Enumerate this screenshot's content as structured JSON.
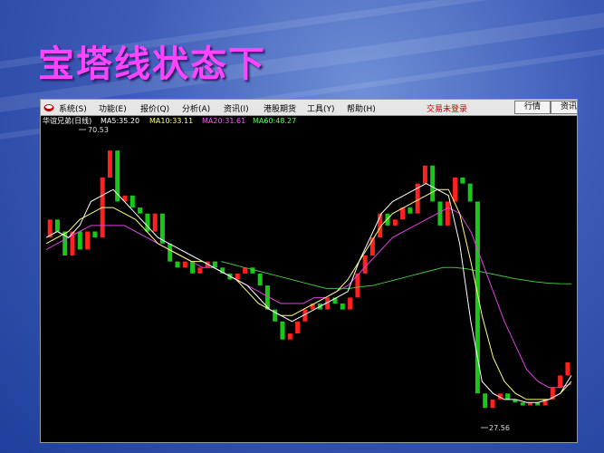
{
  "slide": {
    "title": "宝塔线状态下"
  },
  "menu": {
    "items": [
      "系统(S)",
      "功能(E)",
      "报价(Q)",
      "分析(A)",
      "资讯(I)",
      "港股期货",
      "工具(Y)",
      "帮助(H)"
    ],
    "login_status": "交易未登录",
    "tabs": [
      "行情",
      "资讯"
    ]
  },
  "infobar": {
    "stock": "华谊兄弟(日线)",
    "ma5": "MA5:35.20",
    "ma10": "MA10:33.11",
    "ma20": "MA20:31.61",
    "ma60": "MA60:48.27",
    "label_colors": {
      "stock": "#ffffff",
      "ma5": "#ffffff",
      "ma10": "#ffff66",
      "ma20": "#ff55ff",
      "ma60": "#55ff55"
    }
  },
  "chart_data": {
    "type": "bar",
    "title": "",
    "high_label": "70.53",
    "low_label": "27.56",
    "ylim": [
      24,
      74
    ],
    "colors": {
      "up": "#ff2020",
      "down": "#18c818",
      "ma5": "#ffffff",
      "ma10": "#ffff80",
      "ma20": "#e040e0",
      "ma60": "#40c040"
    },
    "tower_bars": [
      {
        "o": 56,
        "c": 59
      },
      {
        "o": 59,
        "c": 57
      },
      {
        "o": 57,
        "c": 53
      },
      {
        "o": 53,
        "c": 57
      },
      {
        "o": 57,
        "c": 54
      },
      {
        "o": 54,
        "c": 57
      },
      {
        "o": 57,
        "c": 56
      },
      {
        "o": 56,
        "c": 66
      },
      {
        "o": 66,
        "c": 70.5
      },
      {
        "o": 70.5,
        "c": 62
      },
      {
        "o": 62,
        "c": 63
      },
      {
        "o": 63,
        "c": 61
      },
      {
        "o": 61,
        "c": 60
      },
      {
        "o": 60,
        "c": 57
      },
      {
        "o": 57,
        "c": 60
      },
      {
        "o": 60,
        "c": 55
      },
      {
        "o": 55,
        "c": 52
      },
      {
        "o": 52,
        "c": 51
      },
      {
        "o": 51,
        "c": 52
      },
      {
        "o": 52,
        "c": 50
      },
      {
        "o": 50,
        "c": 51
      },
      {
        "o": 51,
        "c": 52
      },
      {
        "o": 52,
        "c": 51
      },
      {
        "o": 51,
        "c": 50
      },
      {
        "o": 50,
        "c": 49
      },
      {
        "o": 49,
        "c": 50
      },
      {
        "o": 50,
        "c": 51
      },
      {
        "o": 51,
        "c": 50
      },
      {
        "o": 50,
        "c": 48
      },
      {
        "o": 48,
        "c": 44
      },
      {
        "o": 44,
        "c": 42
      },
      {
        "o": 42,
        "c": 39
      },
      {
        "o": 39,
        "c": 40
      },
      {
        "o": 40,
        "c": 42
      },
      {
        "o": 42,
        "c": 44
      },
      {
        "o": 44,
        "c": 45
      },
      {
        "o": 45,
        "c": 44
      },
      {
        "o": 44,
        "c": 46
      },
      {
        "o": 46,
        "c": 45
      },
      {
        "o": 45,
        "c": 44
      },
      {
        "o": 44,
        "c": 46
      },
      {
        "o": 46,
        "c": 50
      },
      {
        "o": 50,
        "c": 53
      },
      {
        "o": 53,
        "c": 56
      },
      {
        "o": 56,
        "c": 60
      },
      {
        "o": 60,
        "c": 58
      },
      {
        "o": 58,
        "c": 59
      },
      {
        "o": 59,
        "c": 61
      },
      {
        "o": 61,
        "c": 60
      },
      {
        "o": 60,
        "c": 65
      },
      {
        "o": 65,
        "c": 68
      },
      {
        "o": 68,
        "c": 62
      },
      {
        "o": 62,
        "c": 58
      },
      {
        "o": 58,
        "c": 62
      },
      {
        "o": 62,
        "c": 66
      },
      {
        "o": 66,
        "c": 65
      },
      {
        "o": 65,
        "c": 62
      },
      {
        "o": 62,
        "c": 30
      },
      {
        "o": 30,
        "c": 27.6
      },
      {
        "o": 27.6,
        "c": 29
      },
      {
        "o": 29,
        "c": 30
      },
      {
        "o": 30,
        "c": 29
      },
      {
        "o": 29,
        "c": 28.5
      },
      {
        "o": 28.5,
        "c": 28
      },
      {
        "o": 28,
        "c": 28.5
      },
      {
        "o": 28.5,
        "c": 28
      },
      {
        "o": 28,
        "c": 29
      },
      {
        "o": 29,
        "c": 31
      },
      {
        "o": 31,
        "c": 33
      },
      {
        "o": 33,
        "c": 35.2
      }
    ],
    "ma5": [
      56,
      57,
      56,
      58,
      62,
      63,
      64,
      62,
      60,
      58,
      56,
      55,
      54,
      53,
      52,
      51,
      50,
      49,
      48,
      46,
      44,
      43,
      42,
      43,
      44,
      45,
      46,
      47,
      52,
      56,
      60,
      62,
      63,
      64,
      65,
      64,
      63,
      55,
      42,
      32,
      30,
      29,
      29,
      28.5,
      28.5,
      29,
      30,
      33
    ],
    "ma10": [
      55,
      56,
      57,
      59,
      60,
      61,
      61,
      60,
      59,
      57,
      55,
      54,
      53,
      52,
      52,
      51,
      50,
      49,
      47,
      45,
      44,
      43,
      43,
      44,
      45,
      46,
      47,
      49,
      52,
      55,
      58,
      60,
      61,
      62,
      63,
      64,
      64,
      60,
      52,
      43,
      36,
      32,
      30,
      29,
      29,
      29,
      30,
      32
    ],
    "ma20": [
      54,
      55,
      56,
      57,
      58,
      58,
      58,
      58,
      57,
      56,
      55,
      54,
      53,
      52,
      51,
      51,
      50,
      49,
      48,
      47,
      46,
      45,
      45,
      45,
      46,
      46,
      47,
      48,
      50,
      52,
      54,
      56,
      57,
      58,
      59,
      60,
      61,
      60,
      57,
      52,
      47,
      42,
      38,
      34,
      32,
      31,
      31,
      31.6
    ],
    "ma60": [
      null,
      null,
      null,
      null,
      null,
      null,
      null,
      null,
      null,
      null,
      null,
      null,
      null,
      null,
      null,
      52,
      51.5,
      51,
      50.5,
      50,
      49.5,
      49,
      48.5,
      48,
      47.5,
      47.5,
      47.5,
      47.8,
      48,
      48.5,
      49,
      49.5,
      50,
      50.5,
      51,
      51,
      50.8,
      50.4,
      50,
      49.6,
      49.2,
      48.9,
      48.6,
      48.4,
      48.3,
      48.27
    ]
  }
}
